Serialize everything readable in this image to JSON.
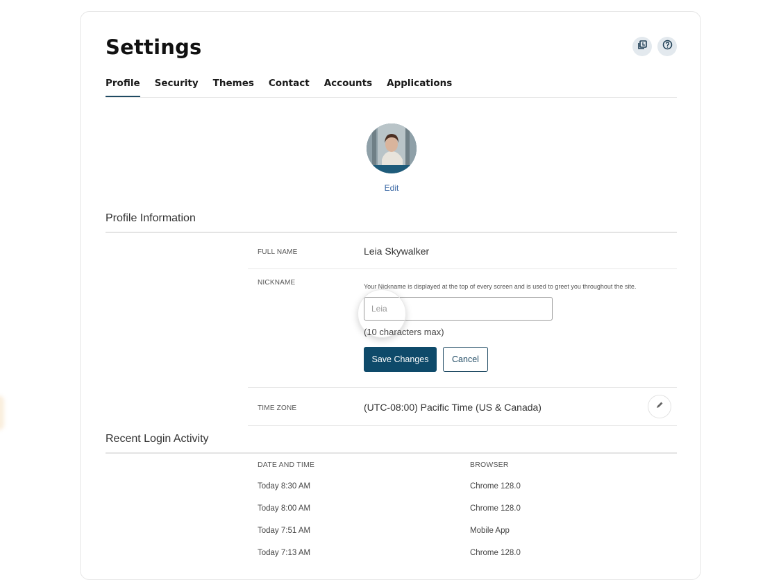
{
  "page": {
    "title": "Settings",
    "header_icons": [
      {
        "name": "copy-icon",
        "label": "Copy"
      },
      {
        "name": "help-icon",
        "label": "Help"
      }
    ]
  },
  "tabs": [
    {
      "label": "Profile",
      "active": true
    },
    {
      "label": "Security",
      "active": false
    },
    {
      "label": "Themes",
      "active": false
    },
    {
      "label": "Contact",
      "active": false
    },
    {
      "label": "Accounts",
      "active": false
    },
    {
      "label": "Applications",
      "active": false
    }
  ],
  "avatar": {
    "edit_label": "Edit",
    "ring_color": "#1e5b7a"
  },
  "profile_information": {
    "heading": "Profile Information",
    "full_name": {
      "label": "FULL NAME",
      "value": "Leia Skywalker"
    },
    "nickname": {
      "label": "NICKNAME",
      "help": "Your Nickname is displayed at the top of every screen and is used to greet you throughout the site.",
      "value": "",
      "placeholder": "Leia",
      "max_note": "(10 characters max)",
      "save_label": "Save Changes",
      "cancel_label": "Cancel"
    },
    "time_zone": {
      "label": "TIME ZONE",
      "value": "(UTC-08:00) Pacific Time (US & Canada)",
      "edit_icon": "pencil-icon"
    }
  },
  "login_activity": {
    "heading": "Recent Login Activity",
    "columns": [
      "DATE AND TIME",
      "BROWSER"
    ],
    "rows": [
      {
        "datetime": "Today 8:30 AM",
        "browser": "Chrome 128.0"
      },
      {
        "datetime": "Today 8:00 AM",
        "browser": "Chrome 128.0"
      },
      {
        "datetime": "Today 7:51 AM",
        "browser": "Mobile App"
      },
      {
        "datetime": "Today 7:13 AM",
        "browser": "Chrome 128.0"
      }
    ]
  },
  "colors": {
    "primary": "#0e4a6a",
    "tab_underline": "#1f4a63",
    "link": "#3d6aa6",
    "icon_button_bg": "#e3e9ee"
  }
}
